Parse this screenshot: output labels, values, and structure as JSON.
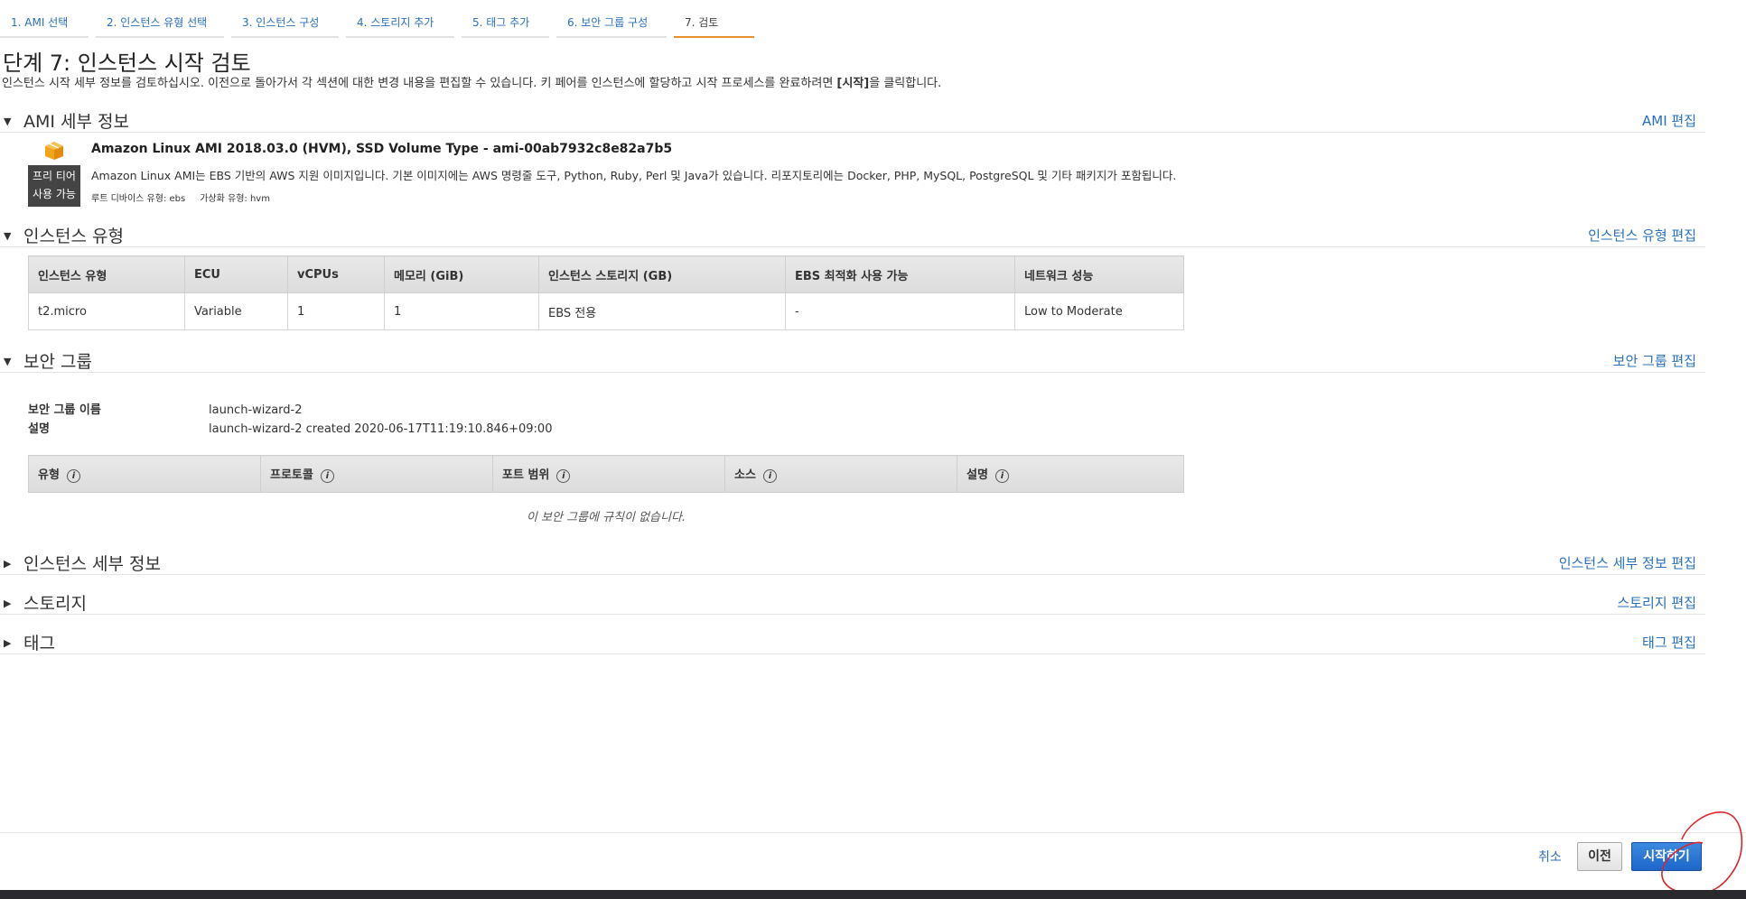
{
  "wizard_tabs": [
    {
      "label": "1. AMI 선택"
    },
    {
      "label": "2. 인스턴스 유형 선택"
    },
    {
      "label": "3. 인스턴스 구성"
    },
    {
      "label": "4. 스토리지 추가"
    },
    {
      "label": "5. 태그 추가"
    },
    {
      "label": "6. 보안 그룹 구성"
    },
    {
      "label": "7. 검토"
    }
  ],
  "page": {
    "title": "단계 7: 인스턴스 시작 검토",
    "desc_before": "인스턴스 시작 세부 정보를 검토하십시오. 이전으로 돌아가서 각 섹션에 대한 변경 내용을 편집할 수 있습니다. 키 페어를 인스턴스에 할당하고 시작 프로세스를 완료하려면 ",
    "desc_bold": "[시작]",
    "desc_after": "을 클릭합니다."
  },
  "ami": {
    "section_title": "AMI 세부 정보",
    "edit_label": "AMI 편집",
    "badge_line1": "프리 티어",
    "badge_line2": "사용 가능",
    "name": "Amazon Linux AMI 2018.03.0 (HVM), SSD Volume Type - ami-00ab7932c8e82a7b5",
    "description": "Amazon Linux AMI는 EBS 기반의 AWS 지원 이미지입니다. 기본 이미지에는 AWS 명령줄 도구, Python, Ruby, Perl 및 Java가 있습니다. 리포지토리에는 Docker, PHP, MySQL, PostgreSQL 및 기타 패키지가 포함됩니다.",
    "root_device": "루트 디바이스 유형: ebs",
    "virtualization": "가상화 유형: hvm",
    "icon": "box-icon"
  },
  "instance_type": {
    "section_title": "인스턴스 유형",
    "edit_label": "인스턴스 유형 편집",
    "headers": [
      "인스턴스 유형",
      "ECU",
      "vCPUs",
      "메모리 (GiB)",
      "인스턴스 스토리지 (GB)",
      "EBS 최적화 사용 가능",
      "네트워크 성능"
    ],
    "row": [
      "t2.micro",
      "Variable",
      "1",
      "1",
      "EBS 전용",
      "-",
      "Low to Moderate"
    ]
  },
  "security_group": {
    "section_title": "보안 그룹",
    "edit_label": "보안 그룹 편집",
    "name_key": "보안 그룹 이름",
    "name_value": "launch-wizard-2",
    "desc_key": "설명",
    "desc_value": "launch-wizard-2 created 2020-06-17T11:19:10.846+09:00",
    "headers": [
      "유형",
      "프로토콜",
      "포트 범위",
      "소스",
      "설명"
    ],
    "empty_message": "이 보안 그룹에 규칙이 없습니다."
  },
  "collapsed_sections": [
    {
      "title": "인스턴스 세부 정보",
      "edit_label": "인스턴스 세부 정보 편집"
    },
    {
      "title": "스토리지",
      "edit_label": "스토리지 편집"
    },
    {
      "title": "태그",
      "edit_label": "태그 편집"
    }
  ],
  "footer": {
    "cancel_label": "취소",
    "previous_label": "이전",
    "launch_label": "시작하기"
  },
  "colors": {
    "link": "#2a6fbd",
    "active_tab_underline": "#e98f2e",
    "primary_button": "#1c66c9",
    "annotation": "#d9262c"
  }
}
